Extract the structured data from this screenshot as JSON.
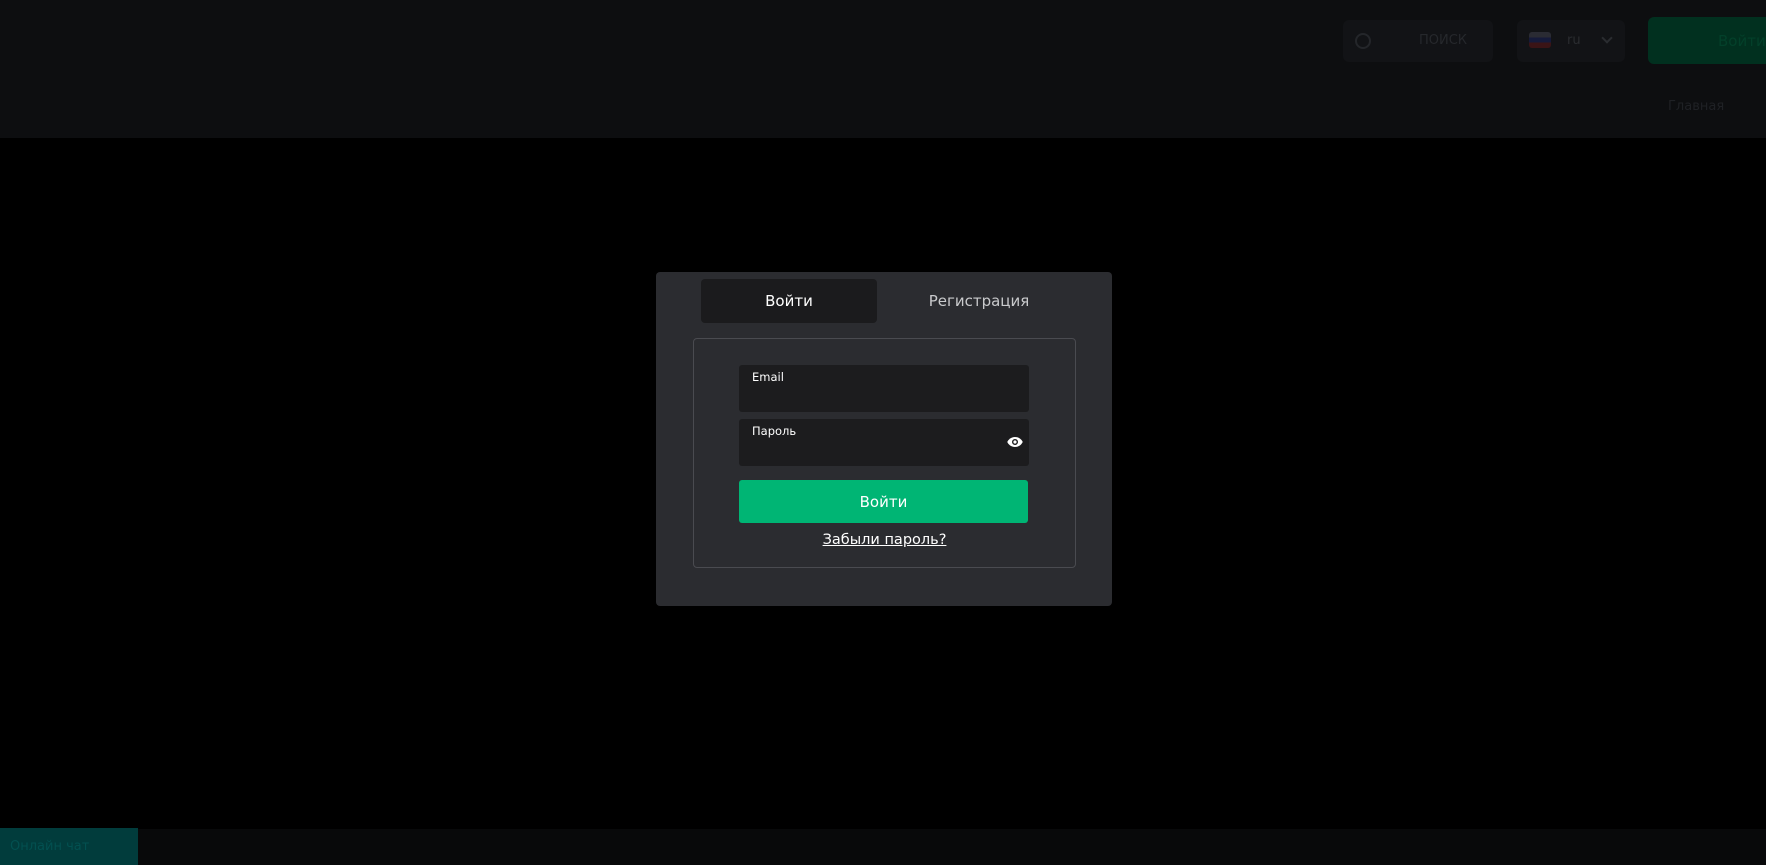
{
  "background": {
    "search_label": "ПОИСК",
    "language": "ru",
    "cta_label": "Войти",
    "subnav_label": "Главная"
  },
  "footer": {
    "chat_label": "Онлайн чат"
  },
  "modal": {
    "tabs": [
      {
        "label": "Войти",
        "active": true
      },
      {
        "label": "Регистрация",
        "active": false
      }
    ],
    "email": {
      "label": "Email",
      "value": ""
    },
    "password": {
      "label": "Пароль",
      "value": "",
      "icon": "eye-icon"
    },
    "submit_label": "Войти",
    "forgot_label": "Забыли пароль?"
  },
  "colors": {
    "accent": "#00b574",
    "modal_bg": "#2b2c30",
    "field_bg": "#1c1c1e"
  }
}
